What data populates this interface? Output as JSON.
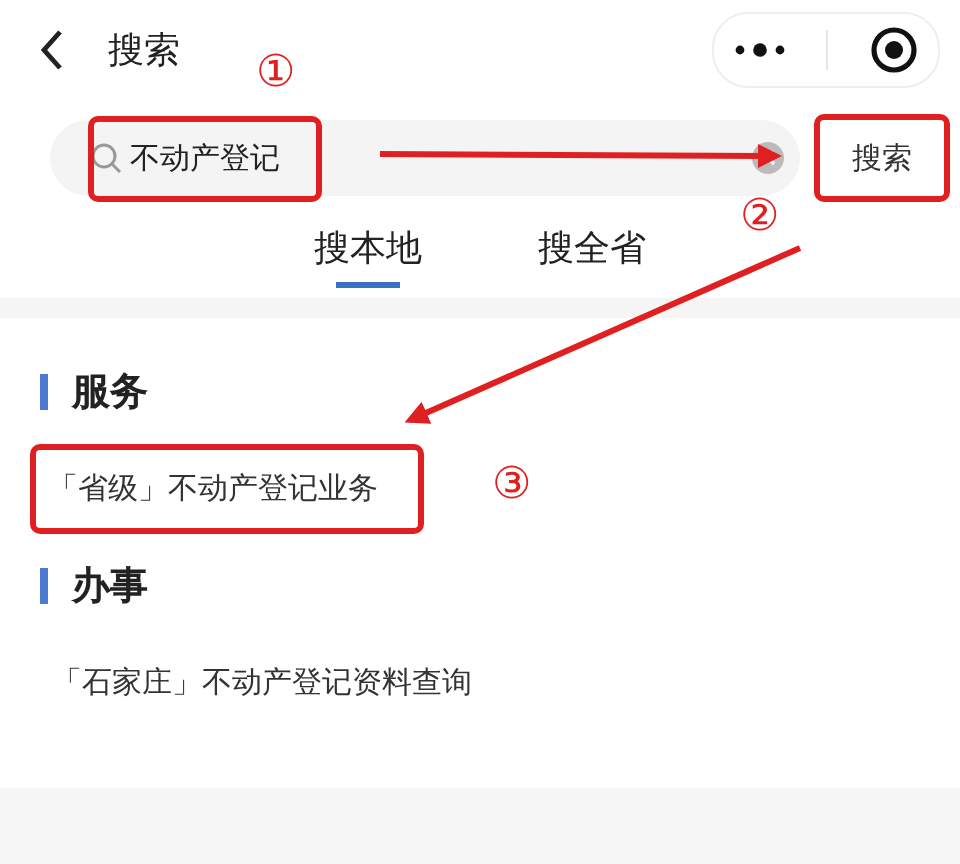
{
  "header": {
    "title": "搜索"
  },
  "search": {
    "value": "不动产登记",
    "value_highlighted": true,
    "button": "搜索",
    "button_highlighted": true
  },
  "tabs": [
    {
      "label": "搜本地",
      "selected": true
    },
    {
      "label": "搜全省",
      "selected": false
    }
  ],
  "sections": [
    {
      "title": "服务",
      "items": [
        {
          "label": "「省级」不动产登记业务",
          "highlighted": true
        }
      ]
    },
    {
      "title": "办事",
      "items": [
        {
          "label": "「石家庄」不动产登记资料查询",
          "highlighted": false
        }
      ]
    }
  ],
  "annotations": [
    "①",
    "②",
    "③"
  ]
}
